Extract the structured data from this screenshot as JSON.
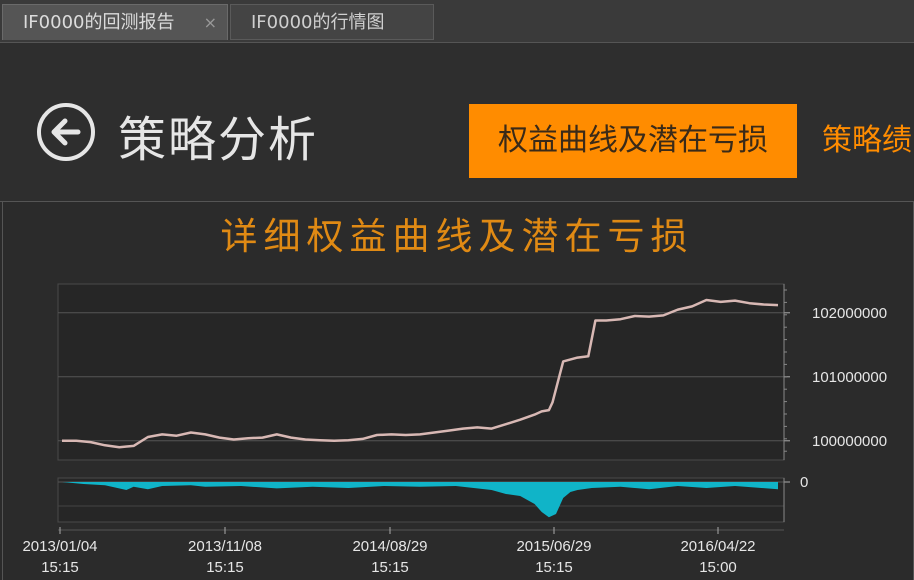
{
  "tabs": [
    {
      "label": "IF0000的回测报告",
      "close": "×"
    },
    {
      "label": "IF0000的行情图"
    }
  ],
  "header": {
    "page_title": "策略分析",
    "active_tab_button": "权益曲线及潜在亏损",
    "next_tab_button": "策略绩"
  },
  "colors": {
    "accent": "#ff8c00",
    "equity_line": "#d8b8b4",
    "drawdown_fill": "#10b4c8"
  },
  "chart_data": {
    "title": "详细权益曲线及潜在亏损",
    "type": "area",
    "x_tick_labels": [
      {
        "date": "2013/01/04",
        "time": "15:15"
      },
      {
        "date": "2013/11/08",
        "time": "15:15"
      },
      {
        "date": "2014/08/29",
        "time": "15:15"
      },
      {
        "date": "2015/06/29",
        "time": "15:15"
      },
      {
        "date": "2016/04/22",
        "time": "15:00"
      }
    ],
    "equity": {
      "y_ticks": [
        100000000,
        101000000,
        102000000
      ],
      "ylim": [
        99700000,
        102450000
      ],
      "x": [
        0,
        0.02,
        0.04,
        0.06,
        0.08,
        0.1,
        0.12,
        0.14,
        0.16,
        0.18,
        0.2,
        0.22,
        0.24,
        0.26,
        0.28,
        0.3,
        0.32,
        0.34,
        0.36,
        0.38,
        0.4,
        0.42,
        0.44,
        0.46,
        0.48,
        0.5,
        0.52,
        0.54,
        0.56,
        0.58,
        0.6,
        0.62,
        0.64,
        0.66,
        0.67,
        0.68,
        0.685,
        0.7,
        0.72,
        0.735,
        0.745,
        0.76,
        0.78,
        0.8,
        0.82,
        0.84,
        0.86,
        0.88,
        0.9,
        0.92,
        0.94,
        0.96,
        0.98,
        1.0
      ],
      "values": [
        100000000,
        100000000,
        99980000,
        99930000,
        99900000,
        99920000,
        100060000,
        100100000,
        100080000,
        100130000,
        100100000,
        100050000,
        100020000,
        100040000,
        100050000,
        100100000,
        100050000,
        100020000,
        100010000,
        100000000,
        100010000,
        100030000,
        100090000,
        100100000,
        100090000,
        100100000,
        100130000,
        100160000,
        100190000,
        100210000,
        100190000,
        100260000,
        100330000,
        100410000,
        100460000,
        100480000,
        100600000,
        101240000,
        101300000,
        101320000,
        101880000,
        101880000,
        101900000,
        101950000,
        101940000,
        101960000,
        102050000,
        102100000,
        102200000,
        102170000,
        102190000,
        102150000,
        102130000,
        102120000
      ]
    },
    "drawdown": {
      "y_ticks": [
        0
      ],
      "ylim": [
        -1.0,
        0.1
      ],
      "x": [
        0,
        0.03,
        0.06,
        0.09,
        0.1,
        0.12,
        0.14,
        0.18,
        0.2,
        0.25,
        0.3,
        0.35,
        0.4,
        0.45,
        0.5,
        0.55,
        0.6,
        0.62,
        0.64,
        0.66,
        0.67,
        0.68,
        0.69,
        0.7,
        0.71,
        0.72,
        0.74,
        0.78,
        0.82,
        0.86,
        0.9,
        0.94,
        0.97,
        1.0
      ],
      "values": [
        0,
        -0.05,
        -0.08,
        -0.2,
        -0.12,
        -0.18,
        -0.1,
        -0.08,
        -0.12,
        -0.1,
        -0.16,
        -0.12,
        -0.15,
        -0.1,
        -0.12,
        -0.1,
        -0.2,
        -0.3,
        -0.35,
        -0.55,
        -0.75,
        -0.88,
        -0.8,
        -0.4,
        -0.25,
        -0.2,
        -0.15,
        -0.12,
        -0.18,
        -0.1,
        -0.15,
        -0.1,
        -0.14,
        -0.18
      ]
    }
  }
}
